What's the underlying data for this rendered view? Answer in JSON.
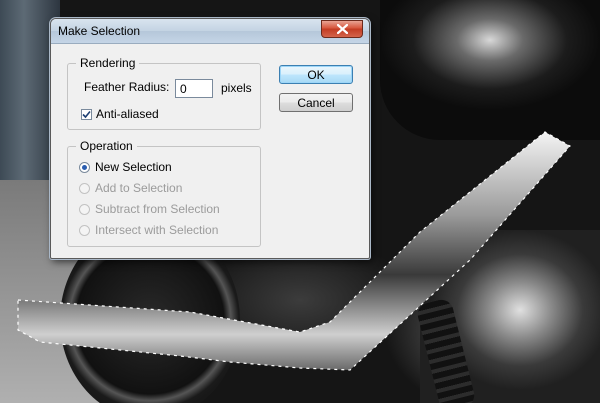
{
  "dialog": {
    "title": "Make Selection",
    "close_icon": "close-icon"
  },
  "rendering": {
    "legend": "Rendering",
    "feather_label": "Feather Radius:",
    "feather_value": "0",
    "feather_unit": "pixels",
    "antialias_label": "Anti-aliased",
    "antialias_checked": true
  },
  "operation": {
    "legend": "Operation",
    "options": [
      {
        "label": "New Selection",
        "selected": true,
        "enabled": true
      },
      {
        "label": "Add to Selection",
        "selected": false,
        "enabled": false
      },
      {
        "label": "Subtract from Selection",
        "selected": false,
        "enabled": false
      },
      {
        "label": "Intersect with Selection",
        "selected": false,
        "enabled": false
      }
    ]
  },
  "buttons": {
    "ok_label": "OK",
    "cancel_label": "Cancel"
  },
  "colors": {
    "accent": "#3c7fb1",
    "close": "#c23b22",
    "radio_dot": "#2a5db0"
  }
}
